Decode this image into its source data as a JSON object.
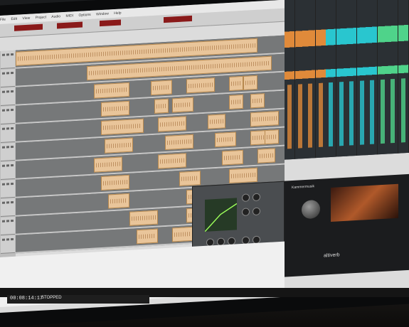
{
  "photo": {
    "subject": "DAW on a monitor",
    "menu": [
      "File",
      "Edit",
      "View",
      "Project",
      "Audio",
      "MIDI",
      "Options",
      "Window",
      "Help"
    ],
    "transport": {
      "time": "00:08:14:17",
      "state": "STOPPED"
    },
    "reverb_plugin": {
      "preset": "Kammermusik",
      "brand": "altiverb"
    },
    "track_count": 11,
    "colors": {
      "clip": "#e9c59a",
      "mixer_cyan": "#29c6cf",
      "mixer_green": "#4fd38a",
      "mixer_orange": "#e08a3a"
    }
  }
}
